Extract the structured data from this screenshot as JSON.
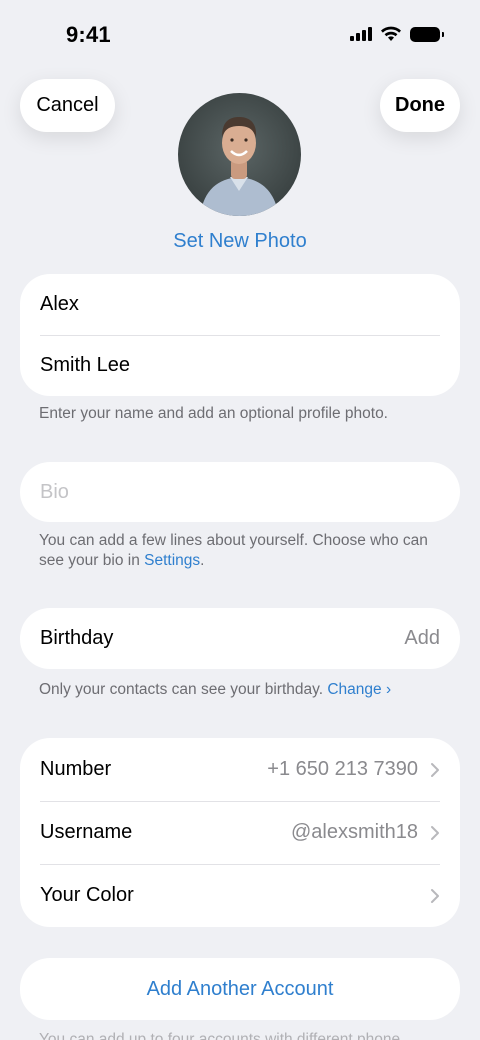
{
  "status_bar": {
    "time": "9:41"
  },
  "header": {
    "cancel_label": "Cancel",
    "done_label": "Done",
    "set_photo_label": "Set New Photo"
  },
  "name_section": {
    "first_name": "Alex",
    "last_name": "Smith Lee",
    "footnote": "Enter your name and add an optional profile photo."
  },
  "bio_section": {
    "placeholder": "Bio",
    "footnote_text": "You can add a few lines about yourself. Choose who can see your bio in ",
    "footnote_link": "Settings",
    "footnote_end": "."
  },
  "birthday_section": {
    "label": "Birthday",
    "value": "Add",
    "footnote_text": "Only your contacts can see your birthday. ",
    "footnote_link": "Change"
  },
  "info_section": {
    "rows": [
      {
        "label": "Number",
        "value": "+1 650 213 7390"
      },
      {
        "label": "Username",
        "value": "@alexsmith18"
      },
      {
        "label": "Your Color",
        "value": ""
      }
    ]
  },
  "accounts": {
    "add_label": "Add Another Account",
    "footnote": "You can add up to four accounts with different phone"
  },
  "colors": {
    "accent": "#2f7fce",
    "background": "#eff0f4"
  }
}
